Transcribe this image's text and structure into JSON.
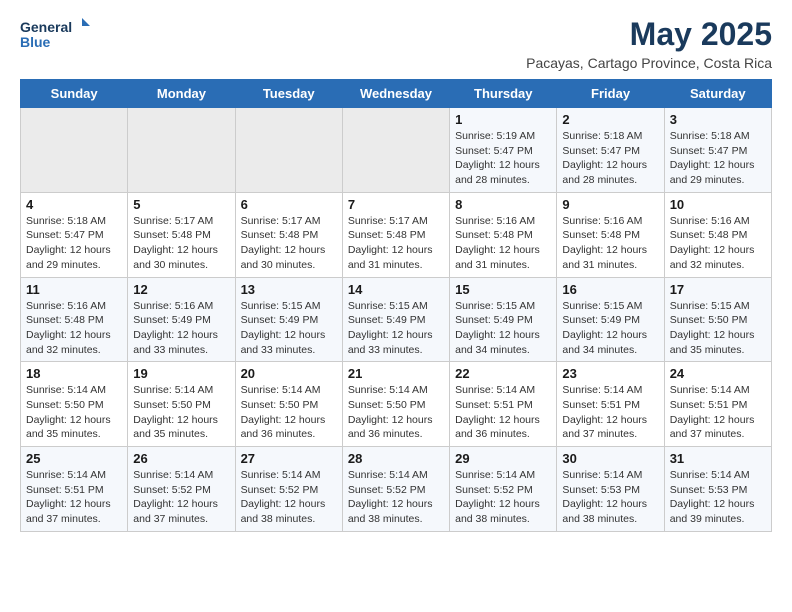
{
  "header": {
    "logo_line1": "General",
    "logo_line2": "Blue",
    "month_title": "May 2025",
    "subtitle": "Pacayas, Cartago Province, Costa Rica"
  },
  "weekdays": [
    "Sunday",
    "Monday",
    "Tuesday",
    "Wednesday",
    "Thursday",
    "Friday",
    "Saturday"
  ],
  "weeks": [
    [
      {
        "day": "",
        "info": ""
      },
      {
        "day": "",
        "info": ""
      },
      {
        "day": "",
        "info": ""
      },
      {
        "day": "",
        "info": ""
      },
      {
        "day": "1",
        "info": "Sunrise: 5:19 AM\nSunset: 5:47 PM\nDaylight: 12 hours\nand 28 minutes."
      },
      {
        "day": "2",
        "info": "Sunrise: 5:18 AM\nSunset: 5:47 PM\nDaylight: 12 hours\nand 28 minutes."
      },
      {
        "day": "3",
        "info": "Sunrise: 5:18 AM\nSunset: 5:47 PM\nDaylight: 12 hours\nand 29 minutes."
      }
    ],
    [
      {
        "day": "4",
        "info": "Sunrise: 5:18 AM\nSunset: 5:47 PM\nDaylight: 12 hours\nand 29 minutes."
      },
      {
        "day": "5",
        "info": "Sunrise: 5:17 AM\nSunset: 5:48 PM\nDaylight: 12 hours\nand 30 minutes."
      },
      {
        "day": "6",
        "info": "Sunrise: 5:17 AM\nSunset: 5:48 PM\nDaylight: 12 hours\nand 30 minutes."
      },
      {
        "day": "7",
        "info": "Sunrise: 5:17 AM\nSunset: 5:48 PM\nDaylight: 12 hours\nand 31 minutes."
      },
      {
        "day": "8",
        "info": "Sunrise: 5:16 AM\nSunset: 5:48 PM\nDaylight: 12 hours\nand 31 minutes."
      },
      {
        "day": "9",
        "info": "Sunrise: 5:16 AM\nSunset: 5:48 PM\nDaylight: 12 hours\nand 31 minutes."
      },
      {
        "day": "10",
        "info": "Sunrise: 5:16 AM\nSunset: 5:48 PM\nDaylight: 12 hours\nand 32 minutes."
      }
    ],
    [
      {
        "day": "11",
        "info": "Sunrise: 5:16 AM\nSunset: 5:48 PM\nDaylight: 12 hours\nand 32 minutes."
      },
      {
        "day": "12",
        "info": "Sunrise: 5:16 AM\nSunset: 5:49 PM\nDaylight: 12 hours\nand 33 minutes."
      },
      {
        "day": "13",
        "info": "Sunrise: 5:15 AM\nSunset: 5:49 PM\nDaylight: 12 hours\nand 33 minutes."
      },
      {
        "day": "14",
        "info": "Sunrise: 5:15 AM\nSunset: 5:49 PM\nDaylight: 12 hours\nand 33 minutes."
      },
      {
        "day": "15",
        "info": "Sunrise: 5:15 AM\nSunset: 5:49 PM\nDaylight: 12 hours\nand 34 minutes."
      },
      {
        "day": "16",
        "info": "Sunrise: 5:15 AM\nSunset: 5:49 PM\nDaylight: 12 hours\nand 34 minutes."
      },
      {
        "day": "17",
        "info": "Sunrise: 5:15 AM\nSunset: 5:50 PM\nDaylight: 12 hours\nand 35 minutes."
      }
    ],
    [
      {
        "day": "18",
        "info": "Sunrise: 5:14 AM\nSunset: 5:50 PM\nDaylight: 12 hours\nand 35 minutes."
      },
      {
        "day": "19",
        "info": "Sunrise: 5:14 AM\nSunset: 5:50 PM\nDaylight: 12 hours\nand 35 minutes."
      },
      {
        "day": "20",
        "info": "Sunrise: 5:14 AM\nSunset: 5:50 PM\nDaylight: 12 hours\nand 36 minutes."
      },
      {
        "day": "21",
        "info": "Sunrise: 5:14 AM\nSunset: 5:50 PM\nDaylight: 12 hours\nand 36 minutes."
      },
      {
        "day": "22",
        "info": "Sunrise: 5:14 AM\nSunset: 5:51 PM\nDaylight: 12 hours\nand 36 minutes."
      },
      {
        "day": "23",
        "info": "Sunrise: 5:14 AM\nSunset: 5:51 PM\nDaylight: 12 hours\nand 37 minutes."
      },
      {
        "day": "24",
        "info": "Sunrise: 5:14 AM\nSunset: 5:51 PM\nDaylight: 12 hours\nand 37 minutes."
      }
    ],
    [
      {
        "day": "25",
        "info": "Sunrise: 5:14 AM\nSunset: 5:51 PM\nDaylight: 12 hours\nand 37 minutes."
      },
      {
        "day": "26",
        "info": "Sunrise: 5:14 AM\nSunset: 5:52 PM\nDaylight: 12 hours\nand 37 minutes."
      },
      {
        "day": "27",
        "info": "Sunrise: 5:14 AM\nSunset: 5:52 PM\nDaylight: 12 hours\nand 38 minutes."
      },
      {
        "day": "28",
        "info": "Sunrise: 5:14 AM\nSunset: 5:52 PM\nDaylight: 12 hours\nand 38 minutes."
      },
      {
        "day": "29",
        "info": "Sunrise: 5:14 AM\nSunset: 5:52 PM\nDaylight: 12 hours\nand 38 minutes."
      },
      {
        "day": "30",
        "info": "Sunrise: 5:14 AM\nSunset: 5:53 PM\nDaylight: 12 hours\nand 38 minutes."
      },
      {
        "day": "31",
        "info": "Sunrise: 5:14 AM\nSunset: 5:53 PM\nDaylight: 12 hours\nand 39 minutes."
      }
    ]
  ]
}
